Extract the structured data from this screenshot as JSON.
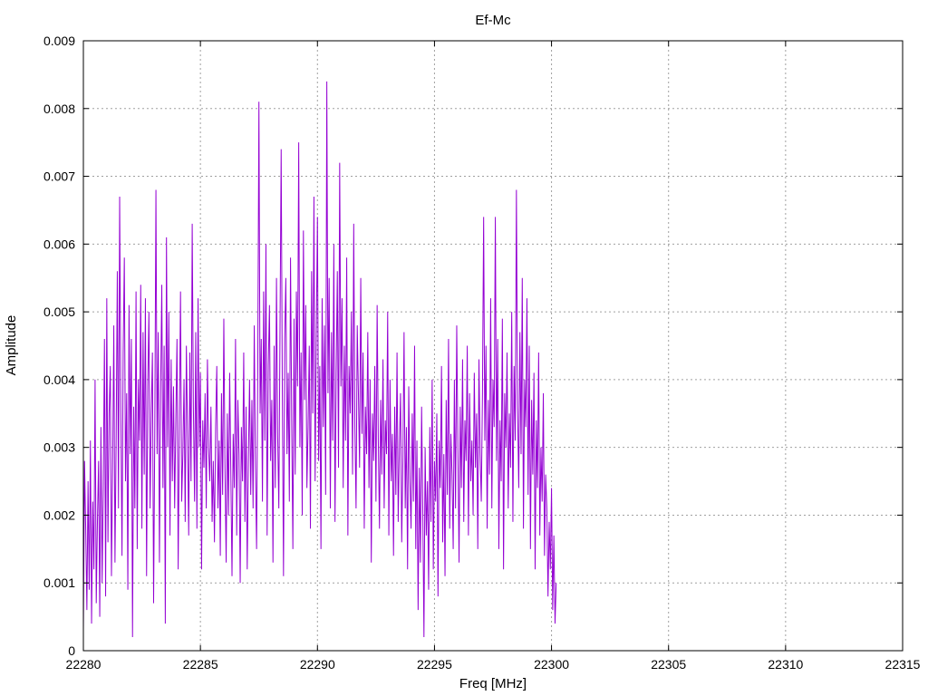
{
  "chart_data": {
    "type": "line",
    "title": "Ef-Mc",
    "xlabel": "Freq [MHz]",
    "ylabel": "Amplitude",
    "xlim": [
      22280,
      22315
    ],
    "ylim": [
      0,
      0.009
    ],
    "x_ticks": [
      "22280",
      "22285",
      "22290",
      "22295",
      "22300",
      "22305",
      "22310",
      "22315"
    ],
    "y_ticks": [
      "0",
      "0.001",
      "0.002",
      "0.003",
      "0.004",
      "0.005",
      "0.006",
      "0.007",
      "0.008",
      "0.009"
    ],
    "grid": true,
    "legend": "none",
    "series": [
      {
        "color": "#9400d3",
        "x_start": 22280.0,
        "x_step": 0.05,
        "values": [
          0.0003,
          0.0028,
          0.0018,
          0.0006,
          0.0025,
          0.0009,
          0.0031,
          0.0004,
          0.0022,
          0.0012,
          0.004,
          0.0007,
          0.0019,
          0.0028,
          0.0005,
          0.0033,
          0.001,
          0.0024,
          0.0046,
          0.0008,
          0.0052,
          0.0016,
          0.0035,
          0.0042,
          0.0011,
          0.0027,
          0.0048,
          0.0013,
          0.0031,
          0.0056,
          0.0021,
          0.0067,
          0.0036,
          0.0014,
          0.0044,
          0.0058,
          0.0025,
          0.0038,
          0.0009,
          0.0051,
          0.0029,
          0.0046,
          0.0002,
          0.0036,
          0.0021,
          0.0053,
          0.0015,
          0.004,
          0.0031,
          0.0054,
          0.0018,
          0.0047,
          0.0026,
          0.0052,
          0.0011,
          0.0039,
          0.005,
          0.0021,
          0.0035,
          0.0044,
          0.0007,
          0.0032,
          0.0068,
          0.0029,
          0.0047,
          0.0013,
          0.0038,
          0.0054,
          0.0024,
          0.0045,
          0.0004,
          0.0061,
          0.003,
          0.005,
          0.0017,
          0.0043,
          0.0025,
          0.0039,
          0.0021,
          0.0034,
          0.0046,
          0.0012,
          0.0033,
          0.0053,
          0.0022,
          0.0029,
          0.004,
          0.0019,
          0.0045,
          0.0032,
          0.0017,
          0.0044,
          0.0025,
          0.0063,
          0.0036,
          0.0022,
          0.0047,
          0.0018,
          0.0052,
          0.003,
          0.0041,
          0.0012,
          0.0034,
          0.0027,
          0.0038,
          0.0021,
          0.0043,
          0.003,
          0.0025,
          0.0036,
          0.0019,
          0.0028,
          0.0016,
          0.0033,
          0.0042,
          0.0021,
          0.0031,
          0.0014,
          0.0038,
          0.0023,
          0.0049,
          0.0027,
          0.0013,
          0.0035,
          0.002,
          0.0041,
          0.0026,
          0.0011,
          0.0032,
          0.0024,
          0.0046,
          0.0017,
          0.0037,
          0.0029,
          0.001,
          0.0033,
          0.0025,
          0.0044,
          0.0019,
          0.0036,
          0.0012,
          0.0028,
          0.004,
          0.0023,
          0.0037,
          0.0021,
          0.0048,
          0.0027,
          0.0015,
          0.0041,
          0.0081,
          0.0035,
          0.0046,
          0.0022,
          0.0053,
          0.0031,
          0.006,
          0.0017,
          0.0042,
          0.0051,
          0.0028,
          0.0037,
          0.0013,
          0.0045,
          0.0024,
          0.0055,
          0.0032,
          0.0021,
          0.0047,
          0.0074,
          0.0038,
          0.0011,
          0.0046,
          0.0055,
          0.0029,
          0.0041,
          0.0022,
          0.0058,
          0.0034,
          0.0015,
          0.0049,
          0.0026,
          0.0053,
          0.0039,
          0.0075,
          0.003,
          0.0044,
          0.002,
          0.0062,
          0.0037,
          0.0051,
          0.0024,
          0.0033,
          0.0045,
          0.0018,
          0.0056,
          0.0035,
          0.0067,
          0.0025,
          0.0046,
          0.0064,
          0.0028,
          0.0042,
          0.0015,
          0.0052,
          0.0033,
          0.0048,
          0.0023,
          0.0084,
          0.0038,
          0.0055,
          0.0021,
          0.0047,
          0.0031,
          0.006,
          0.0019,
          0.0041,
          0.0056,
          0.0027,
          0.0072,
          0.0039,
          0.0052,
          0.0024,
          0.0045,
          0.0031,
          0.0058,
          0.0017,
          0.0042,
          0.0035,
          0.005,
          0.0026,
          0.0063,
          0.0033,
          0.0021,
          0.0048,
          0.0038,
          0.0027,
          0.0055,
          0.0032,
          0.0044,
          0.0018,
          0.0036,
          0.0029,
          0.0047,
          0.0024,
          0.004,
          0.0013,
          0.0035,
          0.0028,
          0.0042,
          0.0022,
          0.0051,
          0.0031,
          0.0018,
          0.0037,
          0.0026,
          0.0043,
          0.0021,
          0.0034,
          0.0029,
          0.005,
          0.0017,
          0.004,
          0.0025,
          0.0032,
          0.0014,
          0.0036,
          0.0023,
          0.0044,
          0.0019,
          0.003,
          0.0038,
          0.0016,
          0.0028,
          0.0047,
          0.0021,
          0.0033,
          0.0012,
          0.0039,
          0.0025,
          0.0018,
          0.0035,
          0.0022,
          0.0045,
          0.0015,
          0.0031,
          0.0006,
          0.0027,
          0.0013,
          0.0036,
          0.0021,
          0.0002,
          0.003,
          0.0017,
          0.0025,
          0.0009,
          0.0033,
          0.0019,
          0.004,
          0.0012,
          0.0028,
          0.0022,
          0.0035,
          0.0008,
          0.0031,
          0.0024,
          0.0042,
          0.0016,
          0.0029,
          0.0011,
          0.0037,
          0.0023,
          0.0046,
          0.0018,
          0.0032,
          0.0026,
          0.0015,
          0.004,
          0.0021,
          0.0048,
          0.003,
          0.0013,
          0.0036,
          0.0024,
          0.0043,
          0.0019,
          0.0034,
          0.0028,
          0.0045,
          0.0017,
          0.0038,
          0.0025,
          0.0031,
          0.002,
          0.0041,
          0.0027,
          0.0035,
          0.0015,
          0.0043,
          0.0029,
          0.0022,
          0.0038,
          0.0064,
          0.0031,
          0.0045,
          0.0018,
          0.0037,
          0.0026,
          0.0052,
          0.0021,
          0.004,
          0.0033,
          0.0064,
          0.0028,
          0.0046,
          0.0015,
          0.0034,
          0.0025,
          0.0049,
          0.0012,
          0.0038,
          0.003,
          0.0044,
          0.0021,
          0.0035,
          0.0027,
          0.005,
          0.0019,
          0.0042,
          0.0031,
          0.0068,
          0.0036,
          0.0024,
          0.0047,
          0.0029,
          0.0055,
          0.0018,
          0.004,
          0.0033,
          0.0052,
          0.0023,
          0.0045,
          0.0015,
          0.0037,
          0.0026,
          0.0041,
          0.0012,
          0.0034,
          0.0024,
          0.0044,
          0.0017,
          0.003,
          0.0022,
          0.0038,
          0.0014,
          0.0026,
          0.0021,
          0.0008,
          0.0019,
          0.0012,
          0.0024,
          0.0006,
          0.0017,
          0.0004,
          0.001
        ]
      }
    ]
  }
}
